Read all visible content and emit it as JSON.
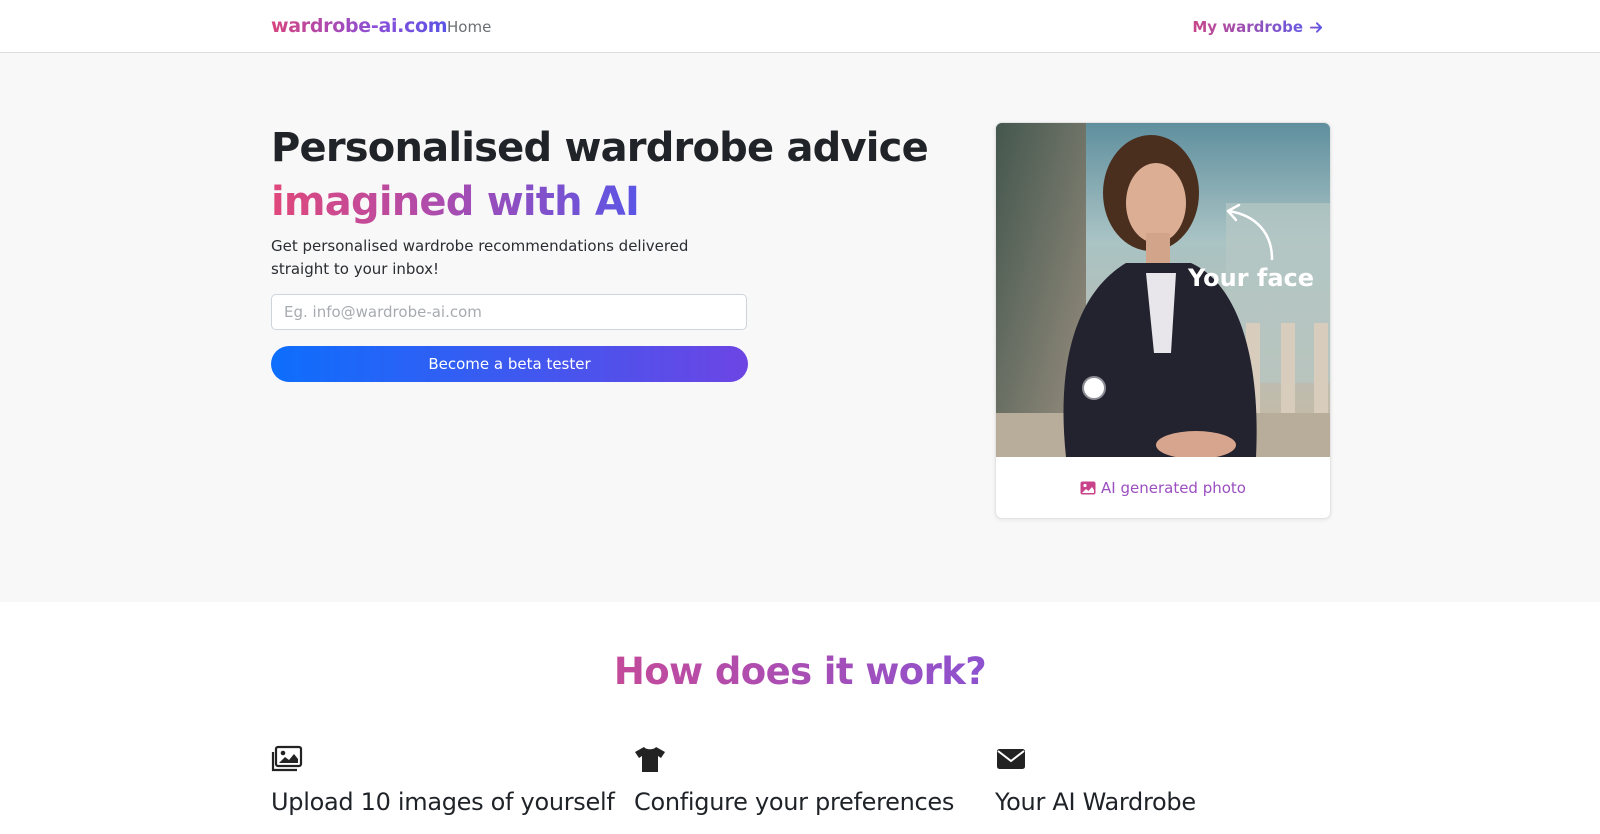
{
  "nav": {
    "brand": "wardrobe-ai.com",
    "home": "Home",
    "my_wardrobe": "My wardrobe"
  },
  "hero": {
    "title_line1": "Personalised wardrobe advice",
    "title_line2": "imagined with AI",
    "subtitle": "Get personalised wardrobe recommendations delivered straight to your inbox!",
    "email_placeholder": "Eg. info@wardrobe-ai.com",
    "cta": "Become a beta tester"
  },
  "card": {
    "overlay_text": "Your face",
    "footer_label": "AI generated photo"
  },
  "how": {
    "heading": "How does it work?",
    "features": [
      {
        "icon": "images-icon",
        "title": "Upload 10 images of yourself",
        "text": ""
      },
      {
        "icon": "tshirt-icon",
        "title": "Configure your preferences",
        "text": ""
      },
      {
        "icon": "envelope-icon",
        "title": "Your AI Wardrobe",
        "text": ""
      }
    ]
  },
  "colors": {
    "brand_pink": "#d6457f",
    "brand_purple": "#8b4fd8",
    "brand_blue": "#5a54e6",
    "cta_start": "#0d6efd",
    "cta_end": "#6c45e4"
  }
}
